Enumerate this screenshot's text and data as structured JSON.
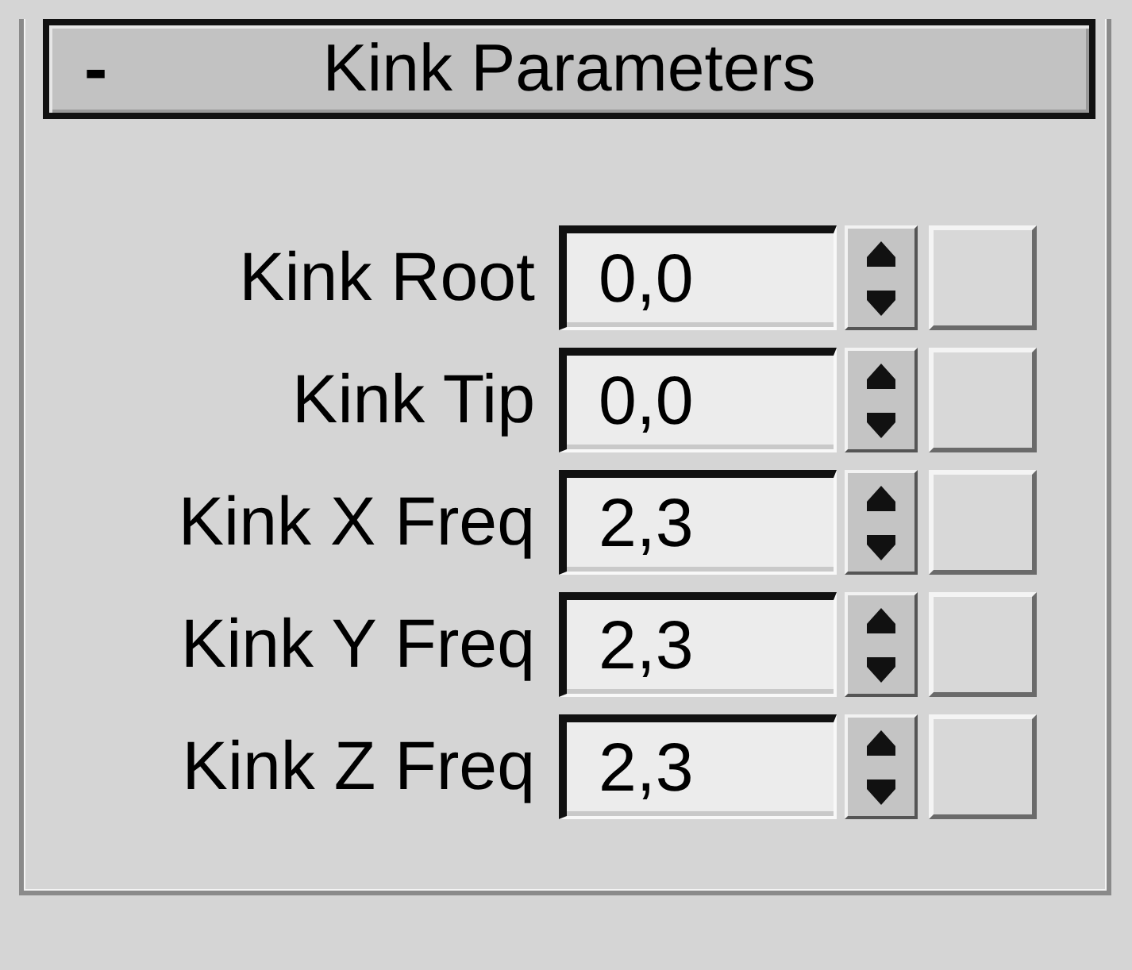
{
  "rollout": {
    "toggle": "-",
    "title": "Kink Parameters"
  },
  "parameters": [
    {
      "label": "Kink Root",
      "value": "0,0"
    },
    {
      "label": "Kink Tip",
      "value": "0,0"
    },
    {
      "label": "Kink X Freq",
      "value": "2,3"
    },
    {
      "label": "Kink Y Freq",
      "value": "2,3"
    },
    {
      "label": "Kink Z Freq",
      "value": "2,3"
    }
  ]
}
